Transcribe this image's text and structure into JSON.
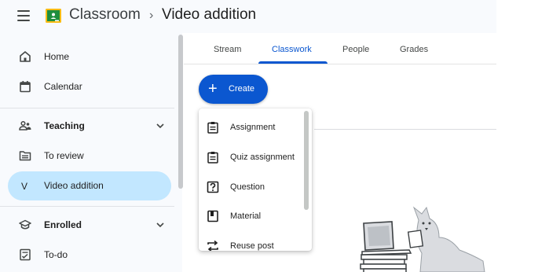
{
  "header": {
    "app_name": "Classroom",
    "separator": "›",
    "class_name": "Video addition"
  },
  "sidebar": {
    "items": [
      {
        "label": "Home",
        "icon": "home-icon"
      },
      {
        "label": "Calendar",
        "icon": "calendar-icon"
      },
      {
        "label": "Teaching",
        "icon": "people-icon"
      },
      {
        "label": "To review",
        "icon": "folder-review-icon"
      },
      {
        "label": "Video addition",
        "icon": "class-avatar",
        "avatar_letter": "V",
        "active": true
      },
      {
        "label": "Enrolled",
        "icon": "mortarboard-icon"
      },
      {
        "label": "To-do",
        "icon": "checklist-icon"
      }
    ]
  },
  "tabs": [
    {
      "label": "Stream"
    },
    {
      "label": "Classwork",
      "active": true
    },
    {
      "label": "People"
    },
    {
      "label": "Grades"
    }
  ],
  "create_button": {
    "label": "Create",
    "icon": "plus-icon"
  },
  "create_menu": {
    "items": [
      {
        "label": "Assignment",
        "icon": "clipboard-icon"
      },
      {
        "label": "Quiz assignment",
        "icon": "quiz-clipboard-icon"
      },
      {
        "label": "Question",
        "icon": "question-icon"
      },
      {
        "label": "Material",
        "icon": "material-icon"
      },
      {
        "label": "Reuse post",
        "icon": "repeat-icon"
      }
    ]
  },
  "colors": {
    "accent": "#0b57d0",
    "active_nav": "#c2e7ff",
    "sidebar_bg": "#f8fafd"
  }
}
